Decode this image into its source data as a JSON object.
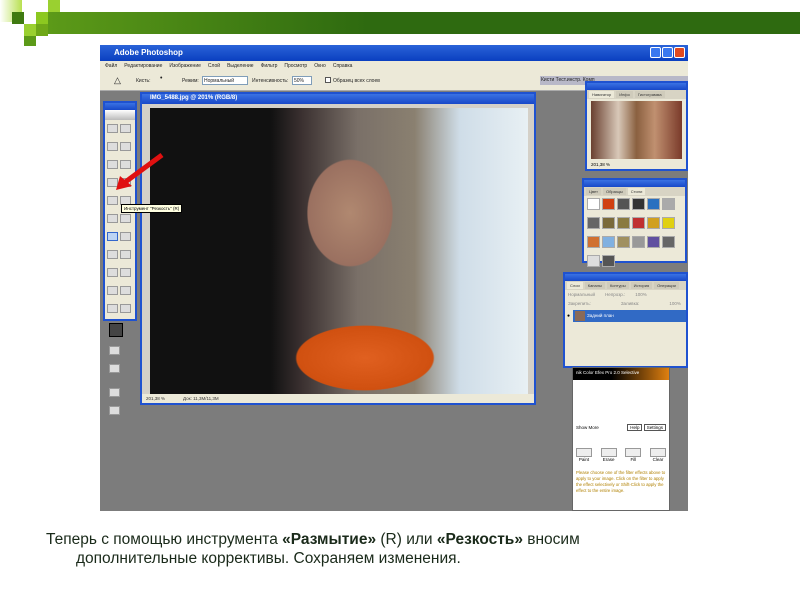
{
  "photoshop": {
    "title": "Adobe Photoshop",
    "menu": [
      "Файл",
      "Редактирование",
      "Изображение",
      "Слой",
      "Выделение",
      "Фильтр",
      "Просмотр",
      "Окно",
      "Справка"
    ],
    "options": {
      "brush_label": "Кисть:",
      "mode_label": "Режим:",
      "mode_value": "Нормальный",
      "intensity_label": "Интенсивность:",
      "intensity_value": "50%",
      "all_layers_label": "Образец всех слоев"
    },
    "palette_well": "Кисти  Тест.инстр.  Комп"
  },
  "document": {
    "title": "IMG_5488.jpg @ 201% (RGB/8)",
    "zoom": "201,38 %",
    "doc_info": "Док: 11,3M/11,3M"
  },
  "toolbox": {
    "tooltip": "Инструмент \"Резкость\" (R)"
  },
  "navigator": {
    "tabs": [
      "Навигатор",
      "Инфо",
      "Гистограмма"
    ],
    "zoom": "201,38 %"
  },
  "styles": {
    "tabs": [
      "Цвет",
      "Образцы",
      "Стили"
    ],
    "colors": [
      "#fff",
      "#d04010",
      "#555",
      "#333",
      "#2a70c0",
      "#aaa",
      "#666",
      "#7a6a3a",
      "#8a7a40",
      "#c03030",
      "#d0a020",
      "#e0d010",
      "#d07030",
      "#80b0e0",
      "#a09060",
      "#999",
      "#6050a0",
      "#666",
      "#ddd",
      "#555"
    ]
  },
  "layers": {
    "tabs": [
      "Слои",
      "Каналы",
      "Контуры",
      "История",
      "Операции"
    ],
    "blend": "Нормальный",
    "opacity_label": "Непрозр.:",
    "opacity": "100%",
    "lock_label": "Закрепить:",
    "fill_label": "Заливка:",
    "fill": "100%",
    "layer_name": "Задний план"
  },
  "nik": {
    "title": "nik Color Efex Pro 2.0 Selective",
    "show_more": "Show More",
    "help": "Help",
    "settings": "Settings",
    "buttons": [
      "Paint",
      "Erase",
      "Fill",
      "Clear"
    ],
    "message": "Please choose one of the filter effects above to apply to your image. Click on the filter to apply the effect selectively or Shift-Click to apply the effect to the entire image."
  },
  "caption": {
    "part1": "Теперь с помощью инструмента ",
    "bold1": "«Размытие»",
    "part2": " (R) или ",
    "bold2": "«Резкость»",
    "part3": " вносим",
    "line2": "дополнительные коррективы. Сохраняем изменения."
  }
}
